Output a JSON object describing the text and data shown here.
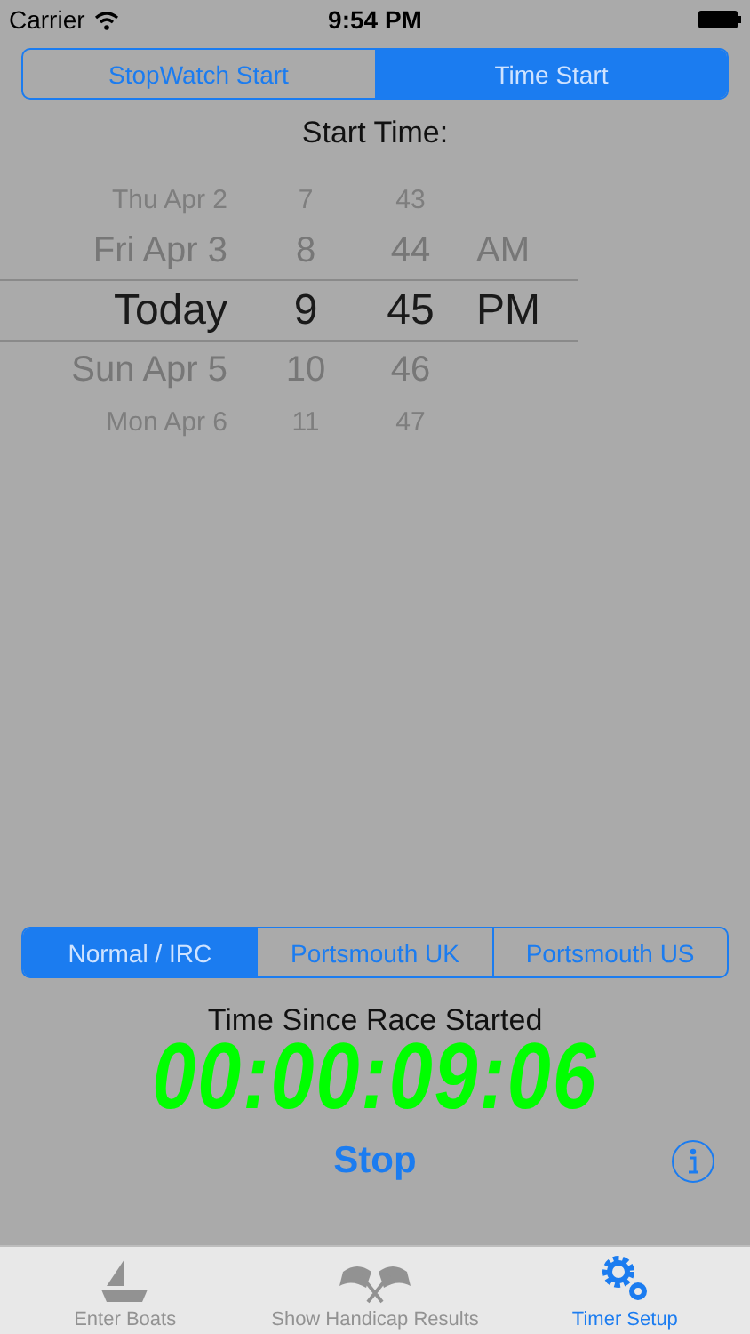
{
  "status_bar": {
    "carrier": "Carrier",
    "time": "9:54 PM"
  },
  "start_mode": [
    {
      "label": "StopWatch Start",
      "selected": false
    },
    {
      "label": "Time Start",
      "selected": true
    }
  ],
  "start_time_label": "Start Time:",
  "picker_rows": [
    {
      "date": "Thu Apr 2",
      "hour": "7",
      "minute": "43",
      "selected": false
    },
    {
      "date": "Fri Apr 3",
      "hour": "8",
      "minute": "44",
      "ampm": "AM",
      "selected": false
    },
    {
      "date": "Today",
      "hour": "9",
      "minute": "45",
      "ampm": "PM",
      "selected": true
    },
    {
      "date": "Sun Apr 5",
      "hour": "10",
      "minute": "46",
      "selected": false
    },
    {
      "date": "Mon Apr 6",
      "hour": "11",
      "minute": "47",
      "selected": false
    }
  ],
  "handicap_mode": [
    {
      "label": "Normal / IRC",
      "selected": true
    },
    {
      "label": "Portsmouth UK",
      "selected": false
    },
    {
      "label": "Portsmouth US",
      "selected": false
    }
  ],
  "elapsed_label": "Time Since Race Started",
  "elapsed_time": "00:00:09:06",
  "stop_button": "Stop",
  "tab_bar": [
    {
      "kind": "boat",
      "label": "Enter Boats",
      "selected": false
    },
    {
      "kind": "flags",
      "label": "Show Handicap Results",
      "selected": false
    },
    {
      "kind": "gears",
      "label": "Timer Setup",
      "selected": true
    }
  ]
}
